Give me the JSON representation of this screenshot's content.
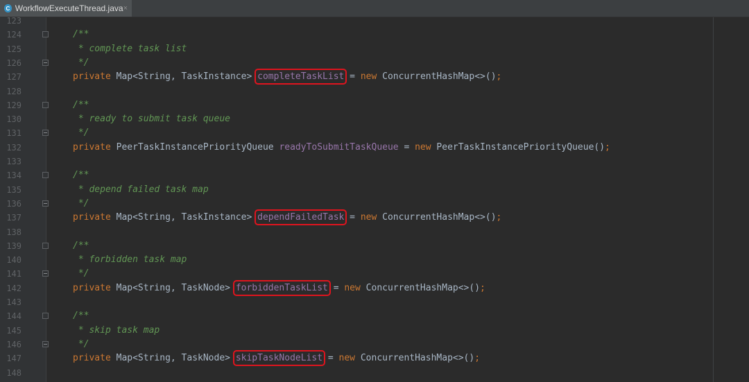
{
  "tab": {
    "file_name": "WorkflowExecuteThread.java",
    "icon": "java-class-icon",
    "close": "×"
  },
  "lines": [
    {
      "num": "123"
    },
    {
      "num": "124",
      "comment": "/**"
    },
    {
      "num": "125",
      "comment": " * complete task list"
    },
    {
      "num": "126",
      "comment": " */"
    },
    {
      "num": "127",
      "kw": "private",
      "type": " Map<String, TaskInstance> ",
      "field": "completeTaskList",
      "eq": " = ",
      "kw2": "new",
      "rest": " ConcurrentHashMap<>()",
      "semi": ";"
    },
    {
      "num": "128"
    },
    {
      "num": "129",
      "comment": "/**"
    },
    {
      "num": "130",
      "comment": " * ready to submit task queue"
    },
    {
      "num": "131",
      "comment": " */"
    },
    {
      "num": "132",
      "kw": "private",
      "type": " PeerTaskInstancePriorityQueue ",
      "field": "readyToSubmitTaskQueue",
      "eq": " = ",
      "kw2": "new",
      "rest": " PeerTaskInstancePriorityQueue()",
      "semi": ";"
    },
    {
      "num": "133"
    },
    {
      "num": "134",
      "comment": "/**"
    },
    {
      "num": "135",
      "comment": " * depend failed task map"
    },
    {
      "num": "136",
      "comment": " */"
    },
    {
      "num": "137",
      "kw": "private",
      "type": " Map<String, TaskInstance> ",
      "field": "dependFailedTask",
      "eq": " = ",
      "kw2": "new",
      "rest": " ConcurrentHashMap<>()",
      "semi": ";"
    },
    {
      "num": "138"
    },
    {
      "num": "139",
      "comment": "/**"
    },
    {
      "num": "140",
      "comment": " * forbidden task map"
    },
    {
      "num": "141",
      "comment": " */"
    },
    {
      "num": "142",
      "kw": "private",
      "type": " Map<String, TaskNode> ",
      "field": "forbiddenTaskList",
      "eq": " = ",
      "kw2": "new",
      "rest": " ConcurrentHashMap<>()",
      "semi": ";"
    },
    {
      "num": "143"
    },
    {
      "num": "144",
      "comment": "/**"
    },
    {
      "num": "145",
      "comment": " * skip task map"
    },
    {
      "num": "146",
      "comment": " */"
    },
    {
      "num": "147",
      "kw": "private",
      "type": " Map<String, TaskNode> ",
      "field": "skipTaskNodeList",
      "eq": " = ",
      "kw2": "new",
      "rest": " ConcurrentHashMap<>()",
      "semi": ";"
    },
    {
      "num": "148"
    }
  ],
  "highlighted_fields": [
    "completeTaskList",
    "dependFailedTask",
    "forbiddenTaskList",
    "skipTaskNodeList"
  ],
  "colors": {
    "keyword": "#cc7832",
    "field": "#9876aa",
    "comment": "#629755",
    "text": "#a9b7c6",
    "highlight_box": "#e0141e",
    "background": "#2b2b2b"
  }
}
